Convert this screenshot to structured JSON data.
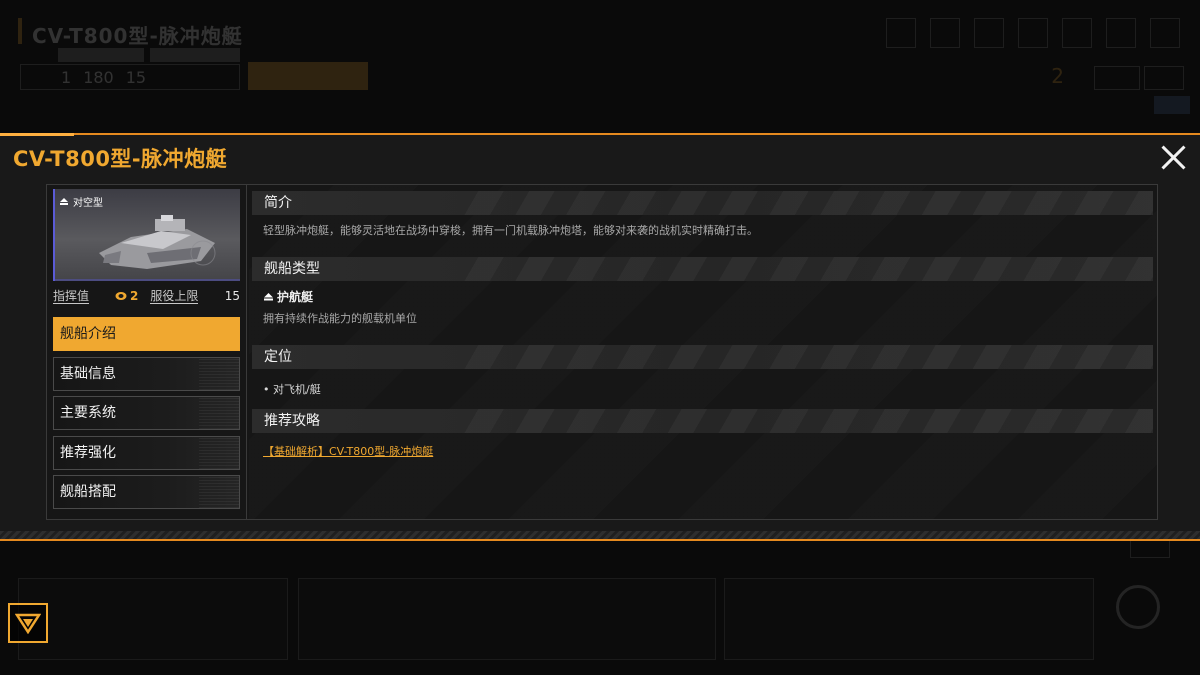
{
  "background": {
    "title": "CV-T800型-脉冲炮艇",
    "stats": [
      "1",
      "180",
      "15"
    ],
    "gold_count": "2"
  },
  "modal": {
    "title": "CV-T800型-脉冲炮艇",
    "close_icon": "close-icon"
  },
  "ship_card": {
    "tag_label": "对空型",
    "tag_icon": "ship-class-icon",
    "command_label": "指挥值",
    "command_value": "2",
    "command_icon": "command-cost-icon",
    "service_label": "服役上限",
    "service_value": "15"
  },
  "tabs": [
    {
      "label": "舰船介绍",
      "active": true
    },
    {
      "label": "基础信息",
      "active": false
    },
    {
      "label": "主要系统",
      "active": false
    },
    {
      "label": "推荐强化",
      "active": false
    },
    {
      "label": "舰船搭配",
      "active": false
    }
  ],
  "sections": {
    "intro": {
      "heading": "简介",
      "text": "轻型脉冲炮艇，能够灵活地在战场中穿梭，拥有一门机载脉冲炮塔，能够对来袭的战机实时精确打击。"
    },
    "ship_type": {
      "heading": "舰船类型",
      "type_name": "护航艇",
      "type_icon": "escort-ship-icon",
      "text": "拥有持续作战能力的舰载机单位"
    },
    "position": {
      "heading": "定位",
      "items": [
        "• 对飞机/艇"
      ]
    },
    "guide": {
      "heading": "推荐攻略",
      "link": "【基础解析】CV-T800型-脉冲炮艇"
    }
  },
  "colors": {
    "accent": "#f0a830",
    "border_orange": "#e58a1f",
    "class_blue": "#5b5bd6"
  }
}
